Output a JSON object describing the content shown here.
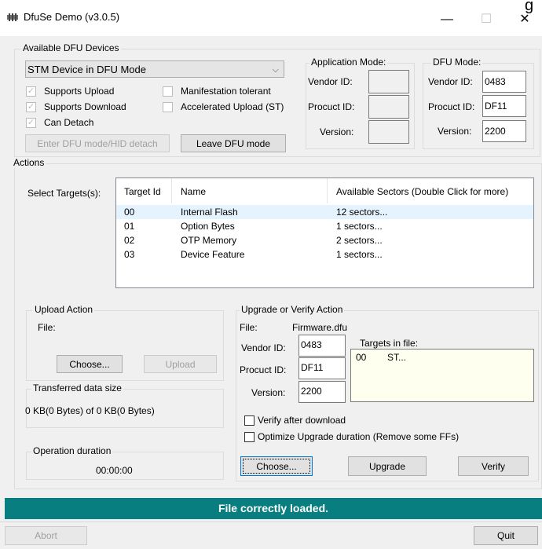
{
  "window": {
    "title": "DfuSe Demo (v3.0.5)",
    "minimize": "—",
    "maximize": "☐",
    "close": "✕",
    "corner_glyph": "g"
  },
  "devices": {
    "group_label": "Available DFU Devices",
    "selected": "STM Device in DFU Mode",
    "options": {
      "supports_upload": "Supports Upload",
      "supports_download": "Supports Download",
      "can_detach": "Can Detach",
      "manifestation_tolerant": "Manifestation tolerant",
      "accelerated_upload": "Accelerated Upload (ST)"
    },
    "enter_dfu_button": "Enter DFU mode/HID detach",
    "leave_dfu_button": "Leave DFU mode"
  },
  "app_mode": {
    "label": "Application Mode:",
    "vendor_label": "Vendor ID:",
    "product_label": "Procuct ID:",
    "version_label": "Version:",
    "vendor": "",
    "product": "",
    "version": ""
  },
  "dfu_mode": {
    "label": "DFU Mode:",
    "vendor_label": "Vendor ID:",
    "product_label": "Procuct ID:",
    "version_label": "Version:",
    "vendor": "0483",
    "product": "DF11",
    "version": "2200"
  },
  "actions": {
    "group_label": "Actions",
    "select_targets_label": "Select Targets(s):",
    "columns": [
      "Target Id",
      "Name",
      "Available Sectors (Double Click for more)"
    ],
    "rows": [
      {
        "id": "00",
        "name": "Internal Flash",
        "sectors": "12 sectors..."
      },
      {
        "id": "01",
        "name": "Option Bytes",
        "sectors": "1 sectors..."
      },
      {
        "id": "02",
        "name": "OTP Memory",
        "sectors": "2 sectors..."
      },
      {
        "id": "03",
        "name": "Device Feature",
        "sectors": "1 sectors..."
      }
    ]
  },
  "upload": {
    "group_label": "Upload Action",
    "file_label": "File:",
    "choose_button": "Choose...",
    "upload_button": "Upload"
  },
  "transferred": {
    "group_label": "Transferred data size",
    "value": "0 KB(0 Bytes) of 0 KB(0 Bytes)"
  },
  "operation": {
    "group_label": "Operation duration",
    "value": "00:00:00"
  },
  "upgrade": {
    "group_label": "Upgrade or Verify Action",
    "file_label": "File:",
    "file_value": "Firmware.dfu",
    "vendor_label": "Vendor ID:",
    "product_label": "Procuct ID:",
    "version_label": "Version:",
    "vendor": "0483",
    "product": "DF11",
    "version": "2200",
    "targets_label": "Targets in file:",
    "targets": [
      {
        "id": "00",
        "name": "ST..."
      }
    ],
    "verify_after_download": "Verify after download",
    "optimize": "Optimize Upgrade duration (Remove some FFs)",
    "choose_button": "Choose...",
    "upgrade_button": "Upgrade",
    "verify_button": "Verify"
  },
  "status_text": "File correctly loaded.",
  "footer": {
    "abort_button": "Abort",
    "quit_button": "Quit"
  }
}
